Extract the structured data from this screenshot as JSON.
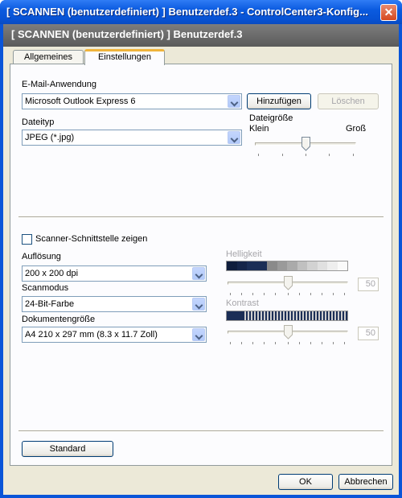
{
  "window": {
    "title": "[ SCANNEN (benutzerdefiniert) ]  Benutzerdef.3 - ControlCenter3-Konfig...",
    "close_glyph": "✕"
  },
  "header": {
    "title": "[ SCANNEN (benutzerdefiniert) ]  Benutzerdef.3"
  },
  "tabs": [
    {
      "label": "Allgemeines",
      "active": false
    },
    {
      "label": "Einstellungen",
      "active": true
    }
  ],
  "email": {
    "label": "E-Mail-Anwendung",
    "value": "Microsoft Outlook Express 6",
    "add_button": "Hinzufügen",
    "delete_button": "Löschen"
  },
  "filetype": {
    "label": "Dateityp",
    "value": "JPEG (*.jpg)"
  },
  "filesize": {
    "label": "Dateigröße",
    "min_label": "Klein",
    "max_label": "Groß",
    "level": 0.5
  },
  "scanner_ui": {
    "label": "Scanner-Schnittstelle zeigen",
    "checked": false
  },
  "resolution": {
    "label": "Auflösung",
    "value": "200 x 200 dpi"
  },
  "scan_mode": {
    "label": "Scanmodus",
    "value": "24-Bit-Farbe"
  },
  "doc_size": {
    "label": "Dokumentengröße",
    "value": "A4 210 x 297 mm (8.3 x 11.7 Zoll)"
  },
  "brightness": {
    "label": "Helligkeit",
    "value": "50",
    "level": 0.5
  },
  "contrast": {
    "label": "Kontrast",
    "value": "50",
    "level": 0.5
  },
  "footer": {
    "default_button": "Standard",
    "ok_button": "OK",
    "cancel_button": "Abbrechen"
  },
  "colors": {
    "titlebar": "#0b5be0",
    "header": "#6b6b6b",
    "tab_accent": "#f0b43b",
    "dialog_bg": "#ece9d8"
  }
}
